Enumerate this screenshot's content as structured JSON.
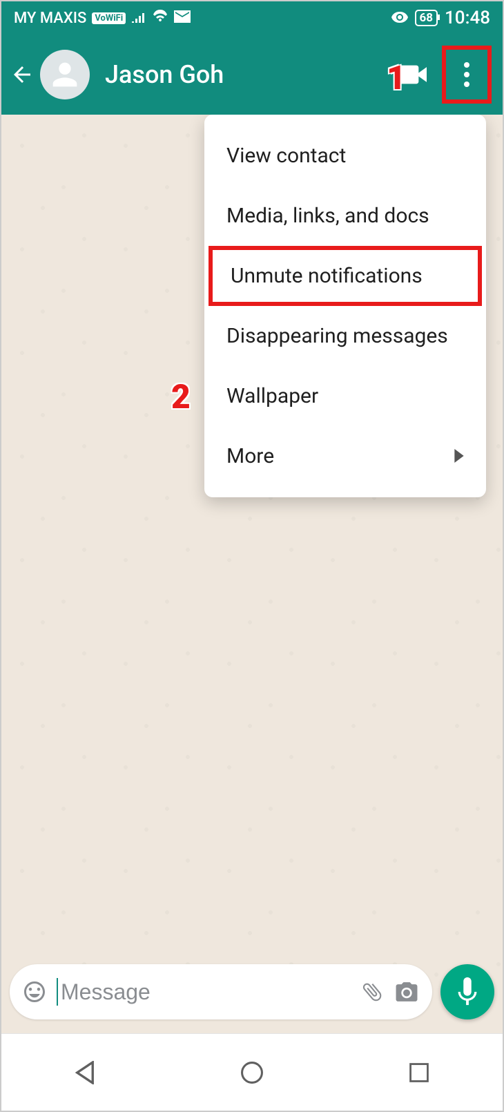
{
  "status_bar": {
    "carrier": "MY MAXIS",
    "vowifi": "VoWiFi",
    "battery": "68",
    "time": "10:48"
  },
  "header": {
    "contact_name": "Jason Goh"
  },
  "menu": {
    "items": [
      "View contact",
      "Media, links, and docs",
      "Unmute notifications",
      "Disappearing messages",
      "Wallpaper",
      "More"
    ]
  },
  "composer": {
    "placeholder": "Message"
  },
  "annotations": {
    "label1": "1",
    "label2": "2"
  }
}
